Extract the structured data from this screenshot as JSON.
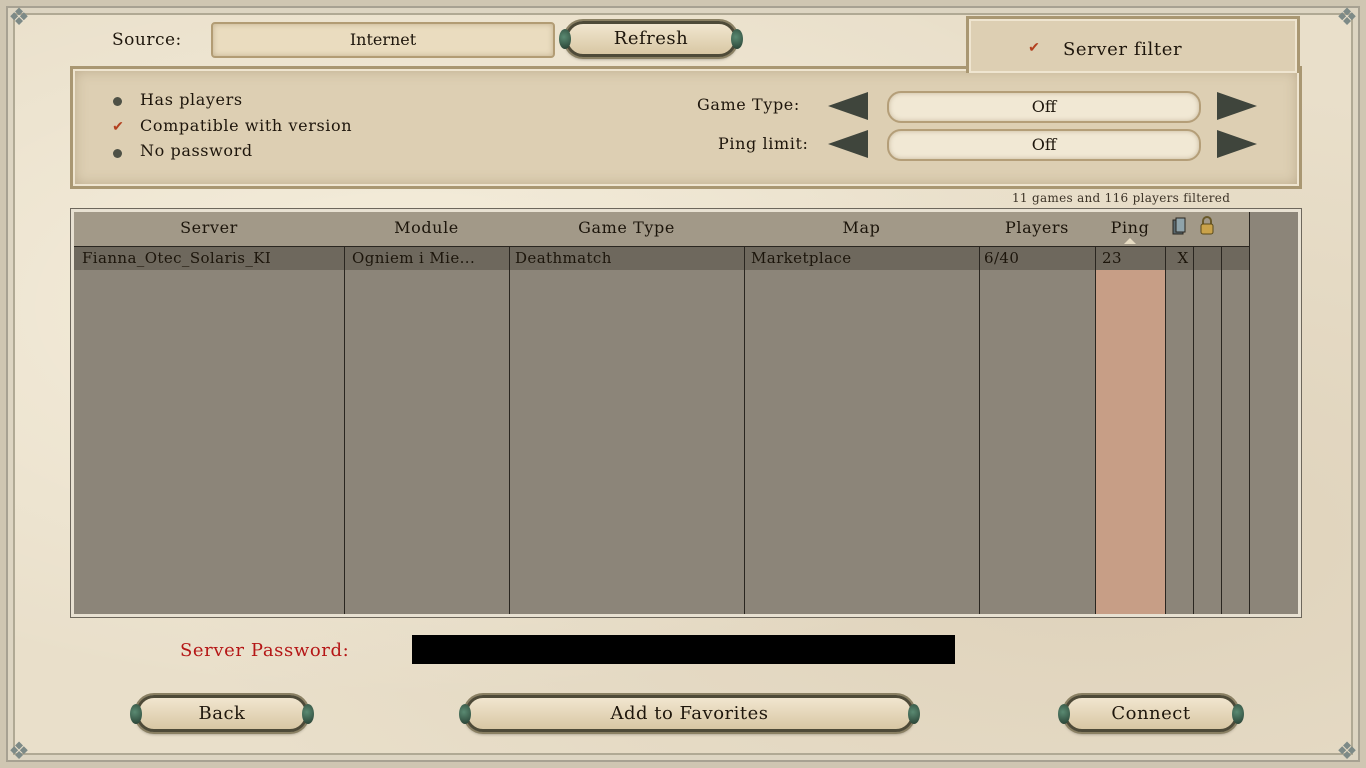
{
  "source": {
    "label": "Source:",
    "value": "Internet",
    "refresh_label": "Refresh"
  },
  "filter": {
    "title": "Server filter",
    "enabled": true,
    "options": [
      {
        "label": "Has players",
        "checked": false
      },
      {
        "label": "Compatible with version",
        "checked": true
      },
      {
        "label": "No password",
        "checked": false
      }
    ],
    "game_type": {
      "label": "Game Type:",
      "value": "Off"
    },
    "ping_limit": {
      "label": "Ping limit:",
      "value": "Off"
    },
    "summary": "11 games and 116 players filtered"
  },
  "table": {
    "columns": [
      "Server",
      "Module",
      "Game Type",
      "Map",
      "Players",
      "Ping"
    ],
    "icon_columns": [
      "version-icon",
      "lock-icon"
    ],
    "sorted_by": "Ping",
    "rows": [
      {
        "server": "Fianna_Otec_Solaris_KI",
        "module": "Ogniem i Mie...",
        "game_type": "Deathmatch",
        "map": "Marketplace",
        "players": "6/40",
        "ping": "23",
        "version_mark": "X",
        "lock_mark": ""
      }
    ]
  },
  "password": {
    "label": "Server Password:",
    "value": ""
  },
  "buttons": {
    "back": "Back",
    "favorites": "Add to Favorites",
    "connect": "Connect"
  },
  "colors": {
    "accent_red": "#b51616",
    "check_red": "#b3401f",
    "ping_highlight": "#c79e86"
  }
}
